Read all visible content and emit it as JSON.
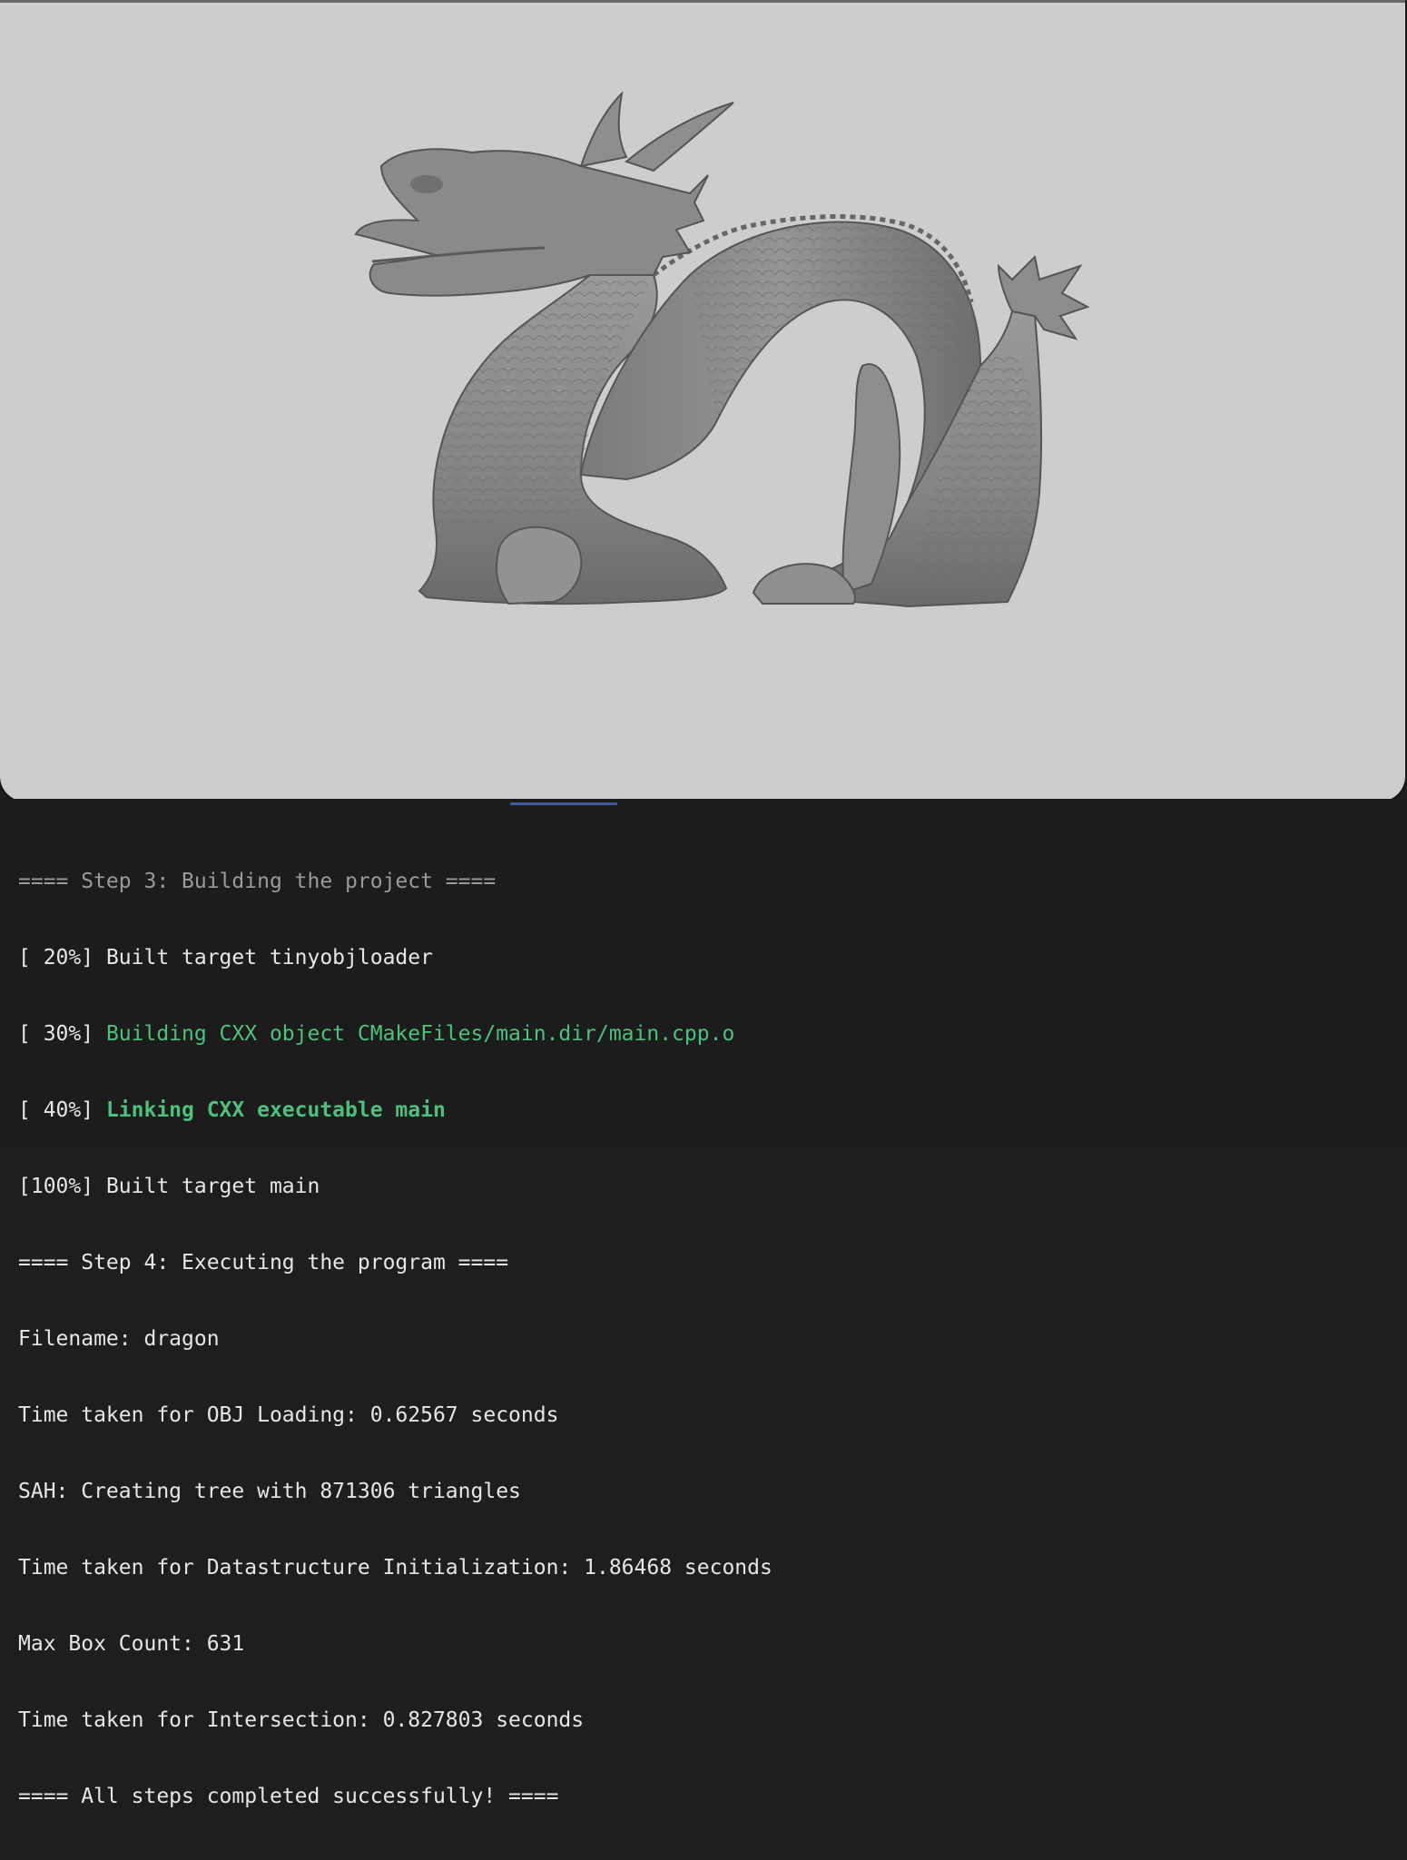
{
  "viewport": {
    "background": "#cdcdcd",
    "model_color": "#8a8a8a",
    "subject": "dragon-model"
  },
  "terminal": {
    "lines": [
      {
        "prefix": "",
        "text": "==== Step 3: Building the project ====",
        "style": "dim"
      },
      {
        "prefix": "[ 20%] ",
        "text": "Built target tinyobjloader",
        "style": "normal"
      },
      {
        "prefix": "[ 30%] ",
        "text": "Building CXX object CMakeFiles/main.dir/main.cpp.o",
        "style": "green"
      },
      {
        "prefix": "[ 40%] ",
        "text": "Linking CXX executable main",
        "style": "green-bold"
      },
      {
        "prefix": "[100%] ",
        "text": "Built target main",
        "style": "normal"
      },
      {
        "prefix": "",
        "text": "==== Step 4: Executing the program ====",
        "style": "normal"
      },
      {
        "prefix": "",
        "text": "Filename: dragon",
        "style": "normal"
      },
      {
        "prefix": "",
        "text": "Time taken for OBJ Loading: 0.62567 seconds",
        "style": "normal"
      },
      {
        "prefix": "",
        "text": "SAH: Creating tree with 871306 triangles",
        "style": "normal"
      },
      {
        "prefix": "",
        "text": "Time taken for Datastructure Initialization: 1.86468 seconds",
        "style": "normal"
      },
      {
        "prefix": "",
        "text": "Max Box Count: 631",
        "style": "normal"
      },
      {
        "prefix": "",
        "text": "Time taken for Intersection: 0.827803 seconds",
        "style": "normal"
      },
      {
        "prefix": "",
        "text": "==== All steps completed successfully! ====",
        "style": "normal"
      }
    ],
    "colors": {
      "text": "#e6e6e6",
      "dim": "#9a9a9a",
      "green": "#4ec07c",
      "background": "#1c1c1c"
    }
  }
}
